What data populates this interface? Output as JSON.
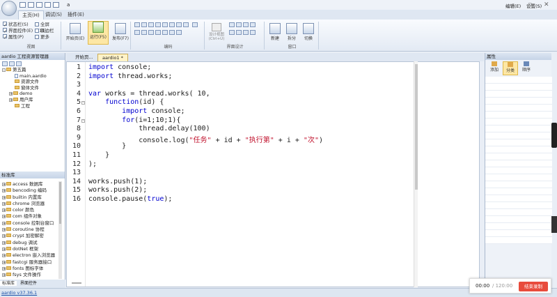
{
  "titlebar": {
    "title": "a",
    "right_menu_editor": "编辑(E)",
    "right_menu_settings": "设置(S)"
  },
  "ribbon_tabs": [
    {
      "label": "主页(H)"
    },
    {
      "label": "调试(S)"
    },
    {
      "label": "插件(E)"
    }
  ],
  "view_group": {
    "label": "视图",
    "status_bar": "状态栏(S)",
    "interface_controls": "界面控件(E)",
    "properties": "属性(P)",
    "fullscreen": "全屏(F11)",
    "sidebar": "侧边栏",
    "more": "更多"
  },
  "run_group": {
    "start_page": "开始页(E)",
    "run": "运行(F5)",
    "publish": "发布(F7)"
  },
  "code_group": {
    "label": "编码"
  },
  "designer_group": {
    "label": "界面设计",
    "design_view": "设计视图",
    "design_view_shortcut": "(Ctrl+U)"
  },
  "window_group": {
    "label": "窗口",
    "new": "新建",
    "split": "拆分",
    "switch": "切换"
  },
  "project_panel": {
    "title": "aardio 工程资源管理器",
    "tree": [
      {
        "label": "第五篇",
        "kind": "folder",
        "level": 0,
        "expand": "-"
      },
      {
        "label": "main.aardio",
        "kind": "file",
        "level": 1
      },
      {
        "label": "资源文件",
        "kind": "folder",
        "level": 1
      },
      {
        "label": "窗体文件",
        "kind": "folder",
        "level": 1
      },
      {
        "label": "demo",
        "kind": "folder",
        "level": 1,
        "expand": "+"
      },
      {
        "label": "用户库",
        "kind": "folder",
        "level": 1,
        "expand": "+"
      },
      {
        "label": "工程",
        "kind": "folder",
        "level": 1
      }
    ]
  },
  "library_panel": {
    "title": "标准库",
    "items": [
      "access 数据库",
      "bencoding 编码",
      "builtin 内置库",
      "chrome 浏览器",
      "color 颜色",
      "com 组件对象",
      "console 控制台窗口",
      "coroutine 协程",
      "crypt 加密解密",
      "debug 调试",
      "dotNet 框架",
      "electron 嵌入浏览器",
      "fastcgi 服务器接口",
      "fonts 图标字体",
      "fsys 文件操作"
    ]
  },
  "bottom_tabs": {
    "stdlib": "标准库",
    "ui_controls": "界面控件"
  },
  "editor_tabs": [
    {
      "label": "开始页..."
    },
    {
      "label": "aardio1 *"
    }
  ],
  "code_lines": [
    [
      {
        "t": "import",
        "c": "kw"
      },
      {
        "t": " console;"
      }
    ],
    [
      {
        "t": "import",
        "c": "kw"
      },
      {
        "t": " thread.works;"
      }
    ],
    [],
    [
      {
        "t": "var",
        "c": "kw"
      },
      {
        "t": " works = thread.works( 10,"
      }
    ],
    [
      {
        "t": "    "
      },
      {
        "t": "function",
        "c": "kw"
      },
      {
        "t": "(id) {"
      }
    ],
    [
      {
        "t": "        "
      },
      {
        "t": "import",
        "c": "kw"
      },
      {
        "t": " console;"
      }
    ],
    [
      {
        "t": "        "
      },
      {
        "t": "for",
        "c": "kw"
      },
      {
        "t": "(i=1;10;1){"
      }
    ],
    [
      {
        "t": "            thread.delay(100)"
      }
    ],
    [
      {
        "t": "            console.log("
      },
      {
        "t": "\"任务\"",
        "c": "st"
      },
      {
        "t": " + id + "
      },
      {
        "t": "\"执行第\"",
        "c": "st"
      },
      {
        "t": " + i + "
      },
      {
        "t": "\"次\"",
        "c": "st"
      },
      {
        "t": ")"
      }
    ],
    [
      {
        "t": "        }"
      }
    ],
    [
      {
        "t": "    }"
      }
    ],
    [
      {
        "t": ");"
      }
    ],
    [],
    [
      {
        "t": "works.push(1);"
      }
    ],
    [
      {
        "t": "works.push(2);"
      }
    ],
    [
      {
        "t": "console.pause("
      },
      {
        "t": "true",
        "c": "kw"
      },
      {
        "t": ");"
      }
    ]
  ],
  "fold_marks": {
    "5": "-",
    "7": "-"
  },
  "properties_panel": {
    "title": "属性",
    "add": "添加",
    "category": "分类",
    "order": "顺序"
  },
  "statusbar": {
    "version": "aardio v37.36.1"
  },
  "recorder": {
    "time": "00:00",
    "limit": "/ 120:00",
    "stop_label": "结束录制"
  }
}
